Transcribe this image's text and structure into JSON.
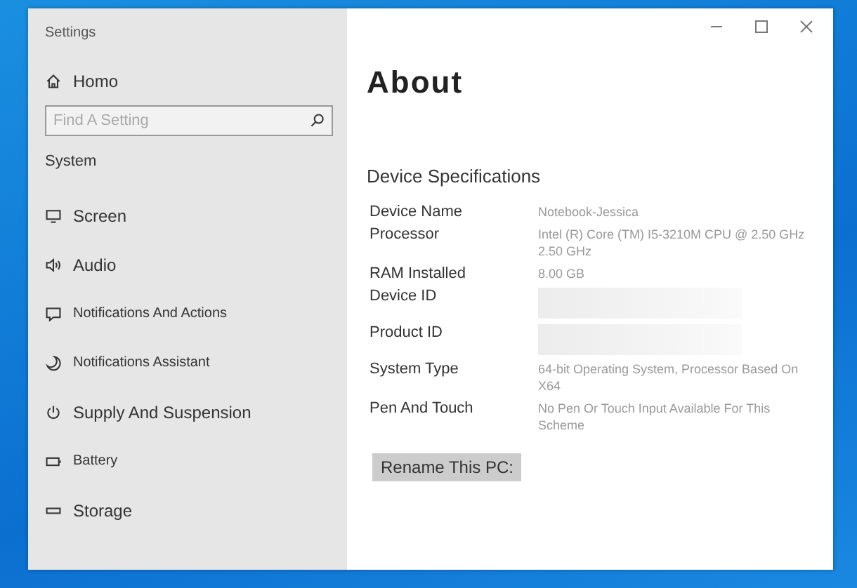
{
  "window": {
    "title": "Settings"
  },
  "sidebar": {
    "home": "Homo",
    "search": {
      "placeholder": "Find A Setting"
    },
    "section": "System",
    "items": [
      {
        "label": "Screen"
      },
      {
        "label": "Audio"
      },
      {
        "label": "Notifications And Actions"
      },
      {
        "label": "Notifications Assistant"
      },
      {
        "label": "Supply And Suspension"
      },
      {
        "label": "Battery"
      },
      {
        "label": "Storage"
      }
    ]
  },
  "content": {
    "title": "About",
    "section": "Device Specifications",
    "rows": [
      {
        "label": "Device Name",
        "kind": "text",
        "value": "Notebook-Jessica"
      },
      {
        "label": "Processor",
        "kind": "text",
        "value": "Intel (R) Core (TM) I5-3210M CPU @ 2.50 GHz 2.50 GHz"
      },
      {
        "label": "RAM Installed",
        "kind": "text",
        "value": "8.00 GB"
      },
      {
        "label": "Device ID",
        "kind": "blurred"
      },
      {
        "label": "Product ID",
        "kind": "blurred"
      },
      {
        "label": "System Type",
        "kind": "text",
        "value": "64-bit Operating System, Processor Based On X64"
      },
      {
        "label": "Pen And Touch",
        "kind": "text",
        "value": "No Pen Or Touch Input Available For This Scheme"
      }
    ],
    "button": "Rename This PC:"
  }
}
